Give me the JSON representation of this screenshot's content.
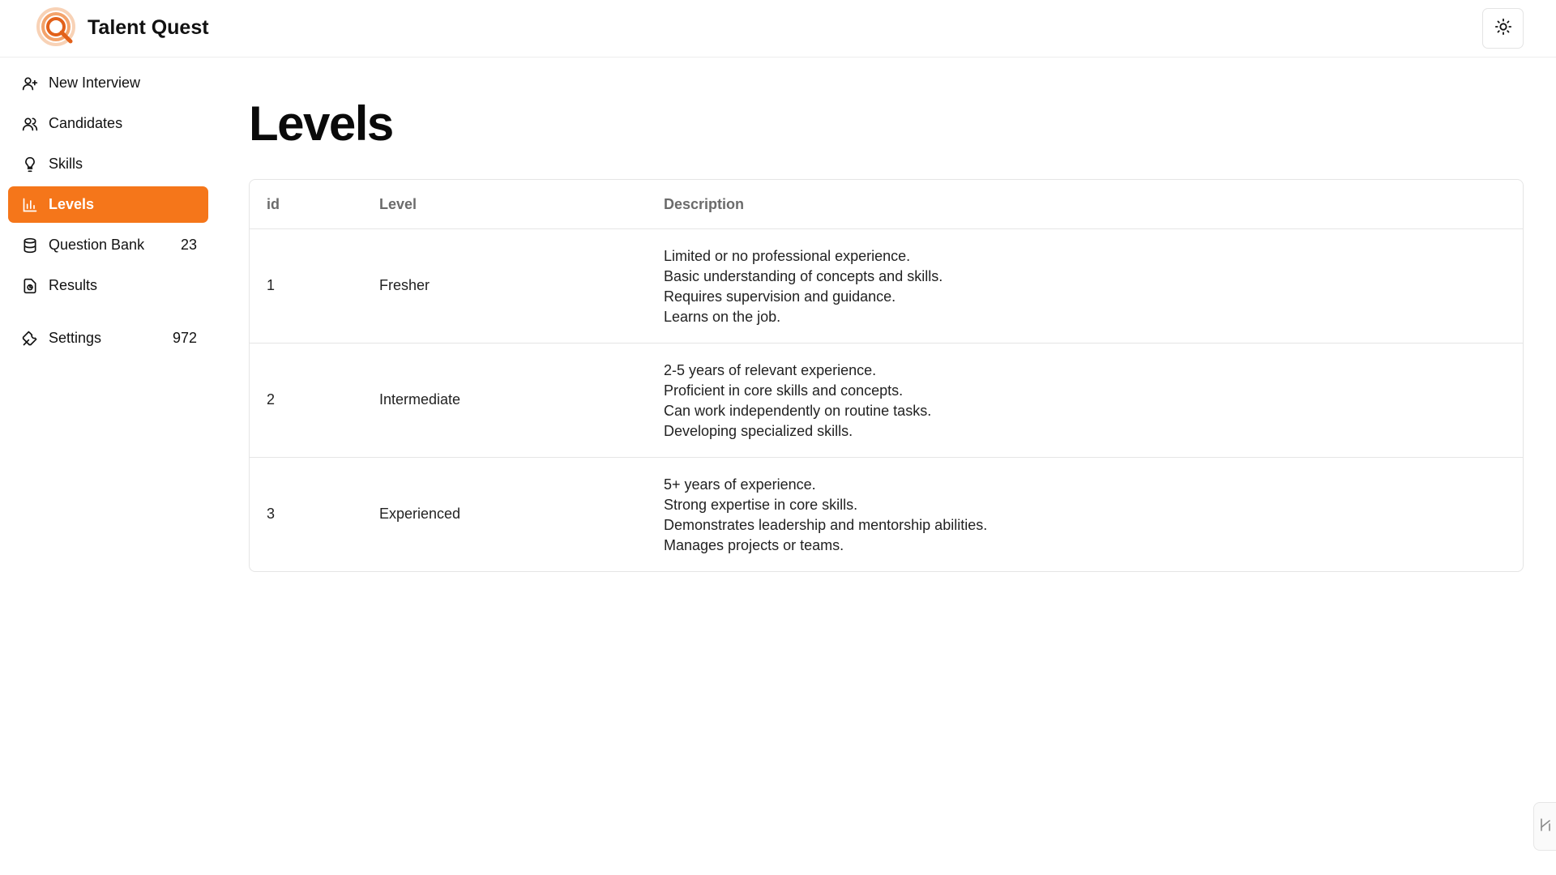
{
  "app": {
    "title": "Talent Quest",
    "accent_color": "#f5761a",
    "logo_icon": "magnifier-logo-icon",
    "theme_toggle_icon": "sun-icon"
  },
  "sidebar": {
    "items": [
      {
        "label": "New Interview",
        "icon": "user-plus-icon",
        "badge": ""
      },
      {
        "label": "Candidates",
        "icon": "users-icon",
        "badge": ""
      },
      {
        "label": "Skills",
        "icon": "lightbulb-icon",
        "badge": ""
      },
      {
        "label": "Levels",
        "icon": "bar-chart-icon",
        "badge": "",
        "active": true
      },
      {
        "label": "Question Bank",
        "icon": "database-icon",
        "badge": "23"
      },
      {
        "label": "Results",
        "icon": "file-chart-icon",
        "badge": ""
      },
      {
        "label": "Settings",
        "icon": "wrench-icon",
        "badge": "972"
      }
    ]
  },
  "main": {
    "title": "Levels",
    "table": {
      "headers": [
        "id",
        "Level",
        "Description"
      ],
      "rows": [
        {
          "id": "1",
          "level": "Fresher",
          "description": [
            "Limited or no professional experience.",
            "Basic understanding of concepts and skills.",
            "Requires supervision and guidance.",
            "Learns on the job."
          ]
        },
        {
          "id": "2",
          "level": "Intermediate",
          "description": [
            "2-5 years of relevant experience.",
            "Proficient in core skills and concepts.",
            "Can work independently on routine tasks.",
            "Developing specialized skills."
          ]
        },
        {
          "id": "3",
          "level": "Experienced",
          "description": [
            "5+ years of experience.",
            "Strong expertise in core skills.",
            "Demonstrates leadership and mentorship abilities.",
            "Manages projects or teams."
          ]
        }
      ]
    }
  }
}
